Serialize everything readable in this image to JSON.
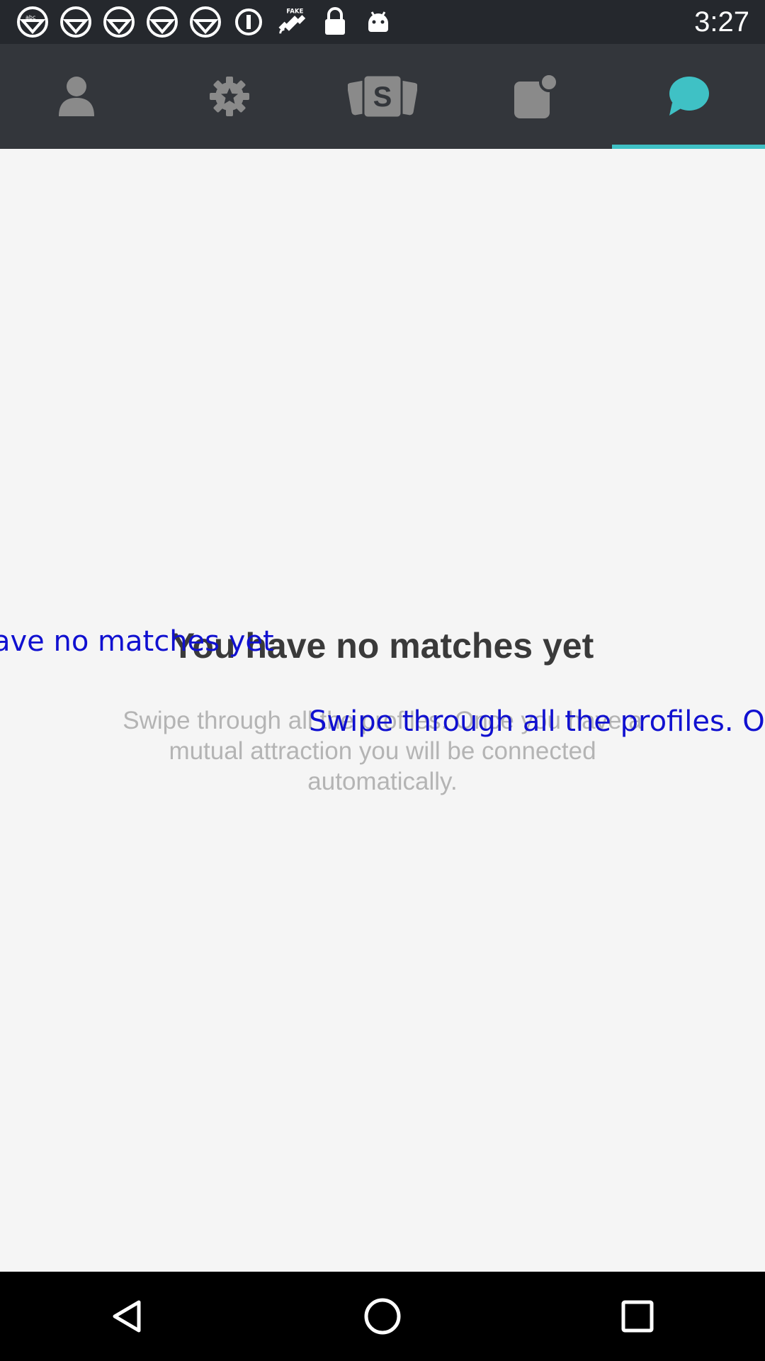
{
  "status_bar": {
    "time": "3:27",
    "icons": [
      "abc7-notification-icon",
      "abc7-notification-icon",
      "abc7-notification-icon",
      "abc7-notification-icon",
      "abc7-notification-icon",
      "info-icon",
      "fake-gps-icon",
      "lock-icon",
      "android-icon"
    ],
    "fake_gps_label": "FAKE",
    "channel_label": "abc"
  },
  "tabs": [
    {
      "name": "profile",
      "icon": "person-icon",
      "active": false
    },
    {
      "name": "settings",
      "icon": "gear-icon",
      "active": false
    },
    {
      "name": "swipe",
      "icon": "cards-icon",
      "icon_letter": "S",
      "active": false
    },
    {
      "name": "notifications",
      "icon": "notification-icon",
      "active": false
    },
    {
      "name": "messages",
      "icon": "chat-bubble-icon",
      "active": true
    }
  ],
  "colors": {
    "accent": "#3fc1c5",
    "tab_bar": "#33363b",
    "status_bar": "#25282d",
    "icon_inactive": "#8a8a8a",
    "overlay_text": "#1010d0"
  },
  "empty_state": {
    "title": "You have no matches yet",
    "description": "Swipe through all the profiles. Once you have a mutual attraction you will be connected automatically."
  },
  "overlay": {
    "title_fragment": "ave no matches yet",
    "description_fragment": "Swipe through all the profiles. On"
  },
  "nav": [
    {
      "name": "back",
      "icon": "back-triangle-icon"
    },
    {
      "name": "home",
      "icon": "home-circle-icon"
    },
    {
      "name": "recents",
      "icon": "recents-square-icon"
    }
  ]
}
